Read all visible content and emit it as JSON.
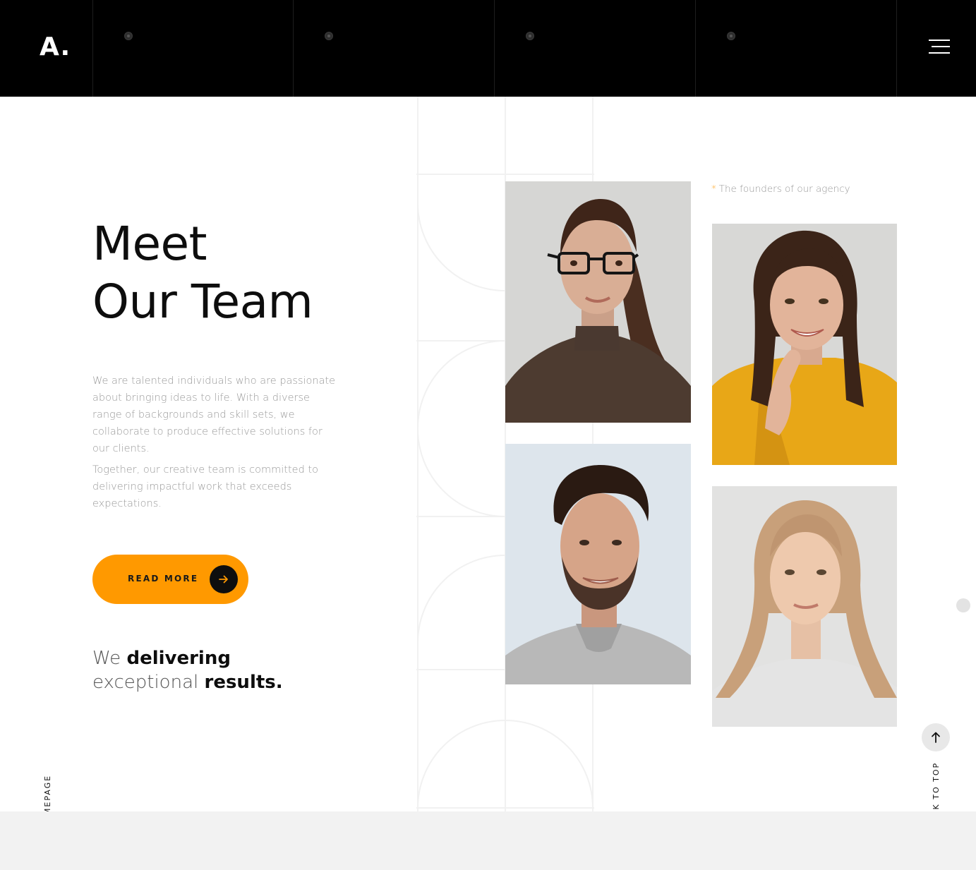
{
  "header": {
    "logo": "A.",
    "menu_icon": "hamburger-menu-icon"
  },
  "main": {
    "title_line1": "Meet",
    "title_line2": "Our Team",
    "paragraph1": "We are talented individuals who are passionate about bringing ideas to life. With a diverse range of backgrounds and skill sets, we collaborate to produce effective solutions for our clients.",
    "paragraph2": "Together, our creative team is committed to delivering impactful work that exceeds expectations.",
    "button_label": "READ MORE",
    "button_icon": "arrow-right-icon",
    "tagline": {
      "w1": "We",
      "w2": "delivering",
      "w3": "exceptional",
      "w4": "results."
    }
  },
  "team": {
    "caption_mark": "*",
    "caption": "The founders of our agency",
    "photos": [
      "woman-with-glasses-photo",
      "woman-yellow-shirt-photo",
      "bearded-man-photo",
      "blonde-woman-photo"
    ]
  },
  "side": {
    "homepage_label": "HOMEPAGE",
    "back_to_top_label": "BACK TO TOP",
    "back_to_top_icon": "arrow-up-icon"
  },
  "colors": {
    "accent": "#ff9900",
    "header_bg": "#000000",
    "text_muted": "#9a9a9a"
  }
}
